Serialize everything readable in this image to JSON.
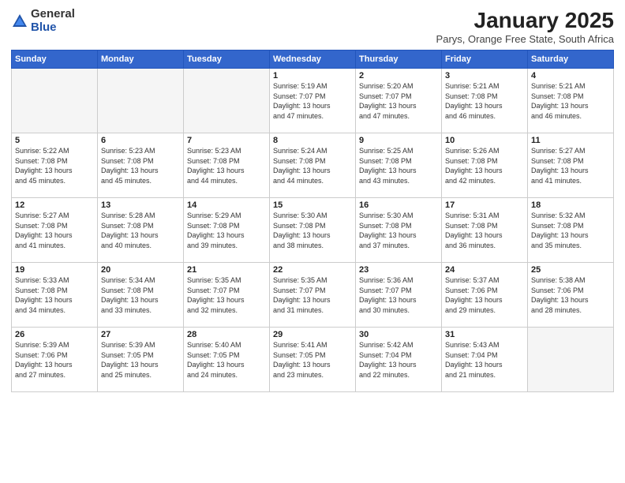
{
  "logo": {
    "general": "General",
    "blue": "Blue"
  },
  "title": "January 2025",
  "subtitle": "Parys, Orange Free State, South Africa",
  "days_header": [
    "Sunday",
    "Monday",
    "Tuesday",
    "Wednesday",
    "Thursday",
    "Friday",
    "Saturday"
  ],
  "weeks": [
    [
      {
        "day": "",
        "info": ""
      },
      {
        "day": "",
        "info": ""
      },
      {
        "day": "",
        "info": ""
      },
      {
        "day": "1",
        "info": "Sunrise: 5:19 AM\nSunset: 7:07 PM\nDaylight: 13 hours\nand 47 minutes."
      },
      {
        "day": "2",
        "info": "Sunrise: 5:20 AM\nSunset: 7:07 PM\nDaylight: 13 hours\nand 47 minutes."
      },
      {
        "day": "3",
        "info": "Sunrise: 5:21 AM\nSunset: 7:08 PM\nDaylight: 13 hours\nand 46 minutes."
      },
      {
        "day": "4",
        "info": "Sunrise: 5:21 AM\nSunset: 7:08 PM\nDaylight: 13 hours\nand 46 minutes."
      }
    ],
    [
      {
        "day": "5",
        "info": "Sunrise: 5:22 AM\nSunset: 7:08 PM\nDaylight: 13 hours\nand 45 minutes."
      },
      {
        "day": "6",
        "info": "Sunrise: 5:23 AM\nSunset: 7:08 PM\nDaylight: 13 hours\nand 45 minutes."
      },
      {
        "day": "7",
        "info": "Sunrise: 5:23 AM\nSunset: 7:08 PM\nDaylight: 13 hours\nand 44 minutes."
      },
      {
        "day": "8",
        "info": "Sunrise: 5:24 AM\nSunset: 7:08 PM\nDaylight: 13 hours\nand 44 minutes."
      },
      {
        "day": "9",
        "info": "Sunrise: 5:25 AM\nSunset: 7:08 PM\nDaylight: 13 hours\nand 43 minutes."
      },
      {
        "day": "10",
        "info": "Sunrise: 5:26 AM\nSunset: 7:08 PM\nDaylight: 13 hours\nand 42 minutes."
      },
      {
        "day": "11",
        "info": "Sunrise: 5:27 AM\nSunset: 7:08 PM\nDaylight: 13 hours\nand 41 minutes."
      }
    ],
    [
      {
        "day": "12",
        "info": "Sunrise: 5:27 AM\nSunset: 7:08 PM\nDaylight: 13 hours\nand 41 minutes."
      },
      {
        "day": "13",
        "info": "Sunrise: 5:28 AM\nSunset: 7:08 PM\nDaylight: 13 hours\nand 40 minutes."
      },
      {
        "day": "14",
        "info": "Sunrise: 5:29 AM\nSunset: 7:08 PM\nDaylight: 13 hours\nand 39 minutes."
      },
      {
        "day": "15",
        "info": "Sunrise: 5:30 AM\nSunset: 7:08 PM\nDaylight: 13 hours\nand 38 minutes."
      },
      {
        "day": "16",
        "info": "Sunrise: 5:30 AM\nSunset: 7:08 PM\nDaylight: 13 hours\nand 37 minutes."
      },
      {
        "day": "17",
        "info": "Sunrise: 5:31 AM\nSunset: 7:08 PM\nDaylight: 13 hours\nand 36 minutes."
      },
      {
        "day": "18",
        "info": "Sunrise: 5:32 AM\nSunset: 7:08 PM\nDaylight: 13 hours\nand 35 minutes."
      }
    ],
    [
      {
        "day": "19",
        "info": "Sunrise: 5:33 AM\nSunset: 7:08 PM\nDaylight: 13 hours\nand 34 minutes."
      },
      {
        "day": "20",
        "info": "Sunrise: 5:34 AM\nSunset: 7:08 PM\nDaylight: 13 hours\nand 33 minutes."
      },
      {
        "day": "21",
        "info": "Sunrise: 5:35 AM\nSunset: 7:07 PM\nDaylight: 13 hours\nand 32 minutes."
      },
      {
        "day": "22",
        "info": "Sunrise: 5:35 AM\nSunset: 7:07 PM\nDaylight: 13 hours\nand 31 minutes."
      },
      {
        "day": "23",
        "info": "Sunrise: 5:36 AM\nSunset: 7:07 PM\nDaylight: 13 hours\nand 30 minutes."
      },
      {
        "day": "24",
        "info": "Sunrise: 5:37 AM\nSunset: 7:06 PM\nDaylight: 13 hours\nand 29 minutes."
      },
      {
        "day": "25",
        "info": "Sunrise: 5:38 AM\nSunset: 7:06 PM\nDaylight: 13 hours\nand 28 minutes."
      }
    ],
    [
      {
        "day": "26",
        "info": "Sunrise: 5:39 AM\nSunset: 7:06 PM\nDaylight: 13 hours\nand 27 minutes."
      },
      {
        "day": "27",
        "info": "Sunrise: 5:39 AM\nSunset: 7:05 PM\nDaylight: 13 hours\nand 25 minutes."
      },
      {
        "day": "28",
        "info": "Sunrise: 5:40 AM\nSunset: 7:05 PM\nDaylight: 13 hours\nand 24 minutes."
      },
      {
        "day": "29",
        "info": "Sunrise: 5:41 AM\nSunset: 7:05 PM\nDaylight: 13 hours\nand 23 minutes."
      },
      {
        "day": "30",
        "info": "Sunrise: 5:42 AM\nSunset: 7:04 PM\nDaylight: 13 hours\nand 22 minutes."
      },
      {
        "day": "31",
        "info": "Sunrise: 5:43 AM\nSunset: 7:04 PM\nDaylight: 13 hours\nand 21 minutes."
      },
      {
        "day": "",
        "info": ""
      }
    ]
  ]
}
